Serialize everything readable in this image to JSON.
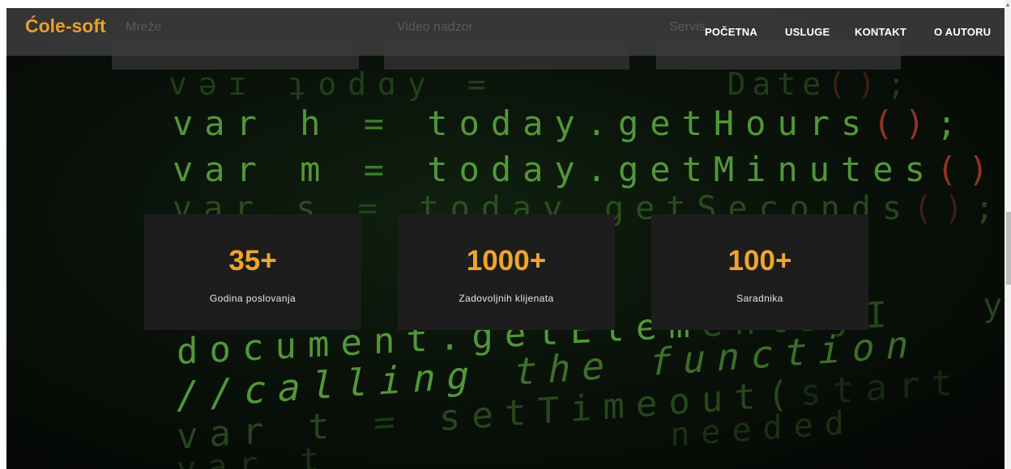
{
  "navbar": {
    "brand": "Ćole-soft",
    "ghost_labels": [
      "Mreže",
      "Video nadzor",
      "Servis"
    ],
    "menu": [
      "POČETNA",
      "USLUGE",
      "KONTAKT",
      "O AUTORU"
    ]
  },
  "stats": [
    {
      "value": "35+",
      "label": "Godina poslovanja"
    },
    {
      "value": "1000+",
      "label": "Zadovoljnih klijenata"
    },
    {
      "value": "100+",
      "label": "Saradnika"
    }
  ],
  "code_lines": [
    "var today = Date();",
    "var h = today.getHours();",
    "var m = today.getMinutes();",
    "var s = today.getSeconds();",
    "document.getElementById",
    "//calling the function",
    "var t = setTimeout(start",
    "var t = //if needed"
  ],
  "colors": {
    "brand": "#e8a02c",
    "stat_value": "#f0a42c",
    "code": "#5fae43"
  }
}
